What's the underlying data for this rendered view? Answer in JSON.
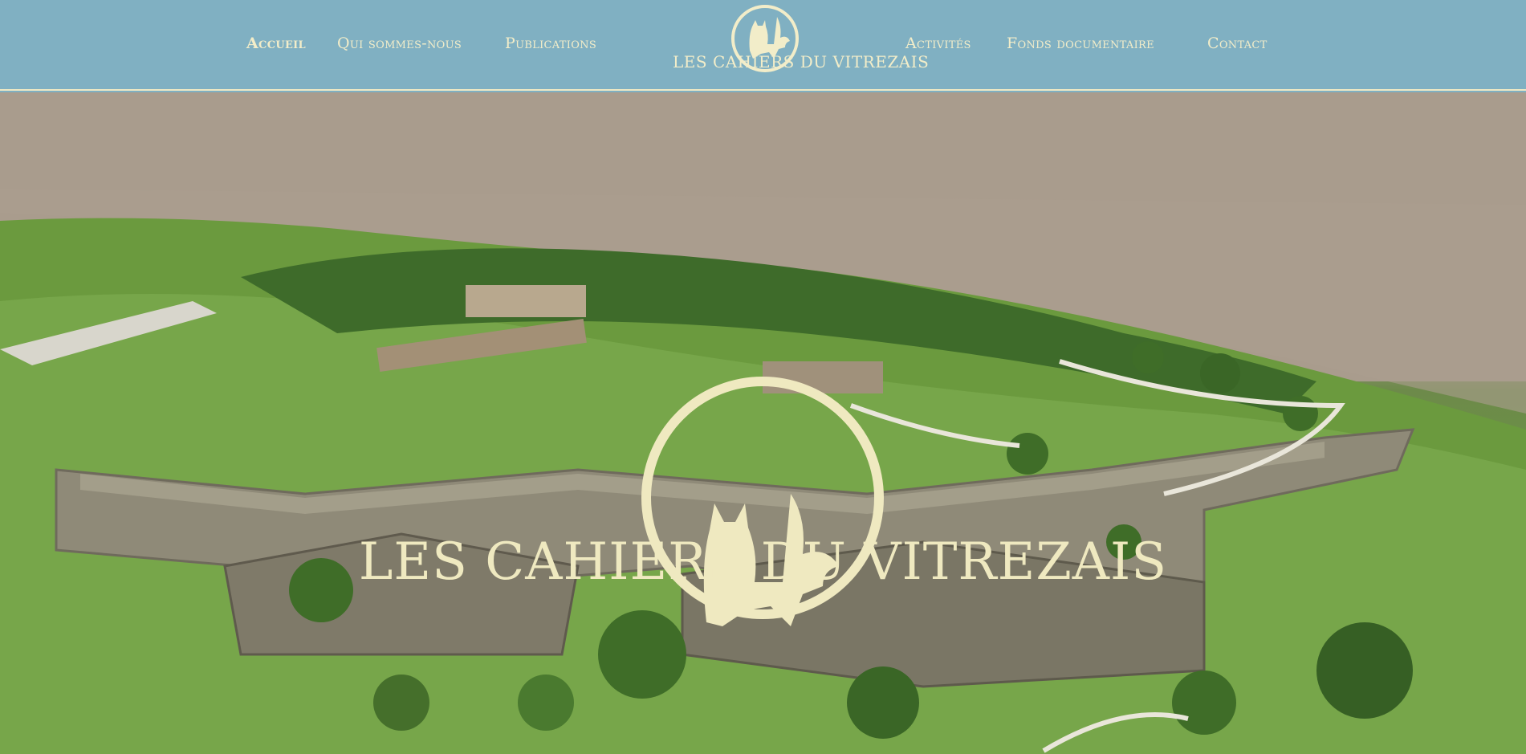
{
  "nav": {
    "left": [
      {
        "label": "Accueil",
        "active": true
      },
      {
        "label": "Qui sommes-nous",
        "active": false
      },
      {
        "label": "Publications",
        "active": false
      }
    ],
    "right": [
      {
        "label": "Activités",
        "active": false
      },
      {
        "label": "Fonds documentaire",
        "active": false
      },
      {
        "label": "Contact",
        "active": false
      }
    ]
  },
  "logo": {
    "text": "LES CAHIERS DU VITREZAIS",
    "icon": "cat-fleur-de-lis-emblem"
  },
  "hero": {
    "title": "LES CAHIERS DU VITREZAIS",
    "image": "aerial-photo-citadel-fortress-riverside"
  },
  "colors": {
    "header_bg": "#80b0c2",
    "accent": "#f2edc9"
  }
}
